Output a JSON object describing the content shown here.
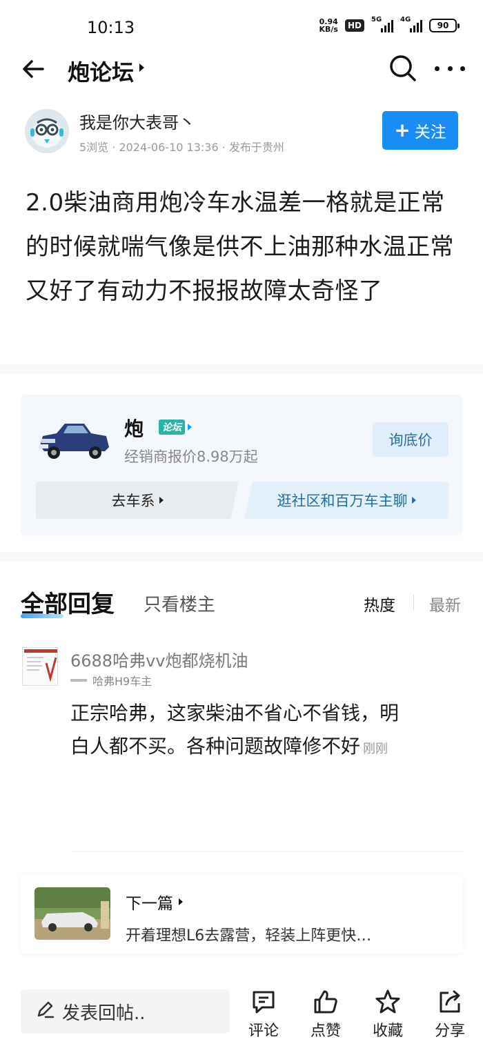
{
  "status_bar": {
    "time": "10:13",
    "net_speed_value": "0.94",
    "net_speed_unit": "KB/s",
    "hd": "HD",
    "signal_1": "5G",
    "signal_2": "4G",
    "battery": "90"
  },
  "header": {
    "title": "炮论坛"
  },
  "author": {
    "name": "我是你大表哥丶",
    "meta": "5浏览 · 2024-06-10 13:36 · 发布于贵州",
    "follow_label": "关注"
  },
  "post": {
    "text": "2.0柴油商用炮冷车水温差一格就是正常的时候就喘气像是供不上油那种水温正常又好了有动力不报报故障太奇怪了"
  },
  "car_card": {
    "name": "炮",
    "badge": "论坛",
    "price": "经销商报价8.98万起",
    "ask_price": "询底价",
    "series_link": "去车系",
    "community_link": "逛社区和百万车主聊"
  },
  "replies": {
    "tab_all": "全部回复",
    "tab_owner": "只看楼主",
    "sort_hot": "热度",
    "sort_new": "最新"
  },
  "comment": {
    "user": "6688哈弗vv炮都烧机油",
    "tagline": "哈弗H9车主",
    "text": "正宗哈弗，这家柴油不省心不省钱，明白人都不买。各种问题故障修不好",
    "time": "刚刚"
  },
  "next_post": {
    "label": "下一篇",
    "title": "开着理想L6去露营，轻装上阵更快…"
  },
  "bottom_bar": {
    "reply_placeholder": "发表回帖..",
    "comment": "评论",
    "like": "点赞",
    "favorite": "收藏",
    "share": "分享"
  },
  "colors": {
    "accent": "#1a8cf5",
    "follow_bg": "#1a8cf5",
    "card_bg": "#f4f7fb"
  },
  "icons": [
    "back-arrow-icon",
    "search-icon",
    "more-icon",
    "pencil-icon",
    "comment-icon",
    "thumbs-up-icon",
    "star-icon",
    "share-icon"
  ]
}
